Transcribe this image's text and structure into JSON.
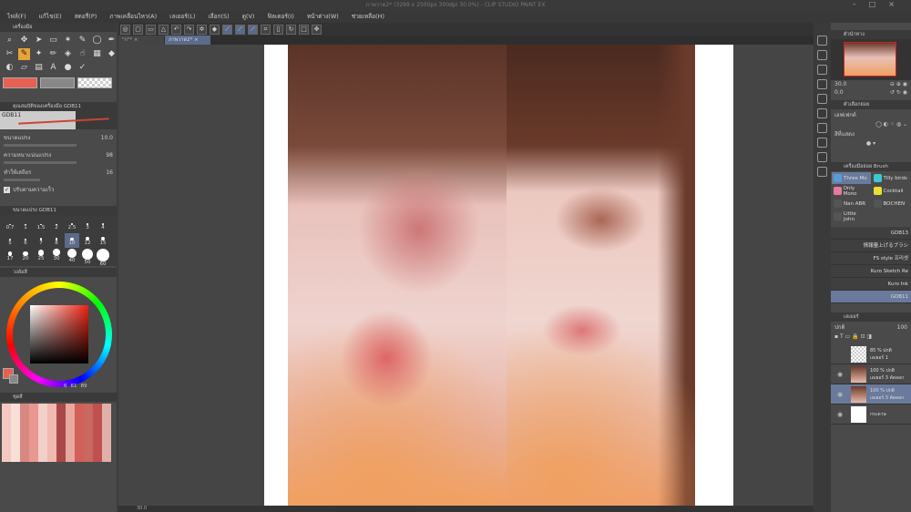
{
  "window": {
    "title": "ภาพวาด2* (3299 x 2500px 300dpi 30.0%) - CLIP STUDIO PAINT EX"
  },
  "menu": [
    "ไฟล์(F)",
    "แก้ไข(E)",
    "สตอรี่(P)",
    "ภาพเคลื่อนไหว(A)",
    "เลเยอร์(L)",
    "เลือก(S)",
    "ดู(V)",
    "ฟิลเตอร์(I)",
    "หน้าต่าง(W)",
    "ช่วยเหลือ(H)"
  ],
  "tabs": [
    {
      "label": "\"ก\"*"
    },
    {
      "label": "ภาพวาด2*"
    }
  ],
  "tool_panel": {
    "title": "เครื่องมือ"
  },
  "tool_property": {
    "title": "คุณสมบัติของเครื่องมือ GDB11",
    "brush_name": "GDB11",
    "brush_size_label": "ขนาดแปรง",
    "brush_size": "10.0",
    "density_label": "ความหนาแน่นแปรง",
    "density": "98",
    "stabilize_label": "ทำให้เสถียร",
    "stabilize": "16",
    "checkbox_label": "ปรับตามความเร็ว"
  },
  "brush_size_panel": {
    "title": "ขนาดแปรง GDB11",
    "sizes": [
      "0.7",
      "1",
      "1.5",
      "2",
      "2.5",
      "3",
      "4",
      "5",
      "6",
      "7",
      "8",
      "10",
      "12",
      "15",
      "17",
      "20",
      "25",
      "30",
      "40",
      "50",
      "60"
    ],
    "selected": "10"
  },
  "color_panel": {
    "title": "วงล้อสี",
    "main_color": "#e8604f",
    "sub_color": "#888888",
    "values": [
      "6",
      "61",
      "89"
    ]
  },
  "palette_panel": {
    "title": "ชุดสี"
  },
  "navigator": {
    "title": "ตัวนำทาง",
    "zoom": "30.0",
    "angle": "0.0"
  },
  "sub_tool": {
    "title": "ตัวเลือกย่อย",
    "effect_label": "เอฟเฟกต์",
    "color_label": "สีที่แสดง"
  },
  "brush_panel": {
    "title": "เครื่องมือย่อย Brush",
    "groups": [
      {
        "name": "Three Mo",
        "color": "#5b9bd5",
        "sel": true
      },
      {
        "name": "Tilly birds",
        "color": "#3cc8d0"
      },
      {
        "name": "Only Mono",
        "color": "#e87aa0"
      },
      {
        "name": "Cocktail",
        "color": "#e8e030"
      },
      {
        "name": "Nan ABR",
        "color": ""
      },
      {
        "name": "BOCHEN",
        "color": ""
      },
      {
        "name": "Little John",
        "color": ""
      }
    ],
    "brushes": [
      "GDB13",
      "情報量上げるブラシ",
      "FS style 프리셋",
      "Kuro Sketch Re",
      "Kuro Ink",
      "GDB11"
    ],
    "selected": "GDB11"
  },
  "layer_panel": {
    "title": "เลเยอร์",
    "blend": "ปกติ",
    "opacity": "100",
    "layers": [
      {
        "pct": "85 % ปกติ",
        "name": "เลเยอร์ 1",
        "visible": false
      },
      {
        "pct": "100 % ปกติ",
        "name": "เลเยอร์ 3 คัดลอก",
        "visible": true
      },
      {
        "pct": "100 % ปกติ",
        "name": "เลเยอร์ 3 คัดลอก",
        "visible": true,
        "sel": true
      },
      {
        "pct": "",
        "name": "กระดาษ",
        "visible": true
      }
    ]
  },
  "status": {
    "zoom": "30.0"
  }
}
